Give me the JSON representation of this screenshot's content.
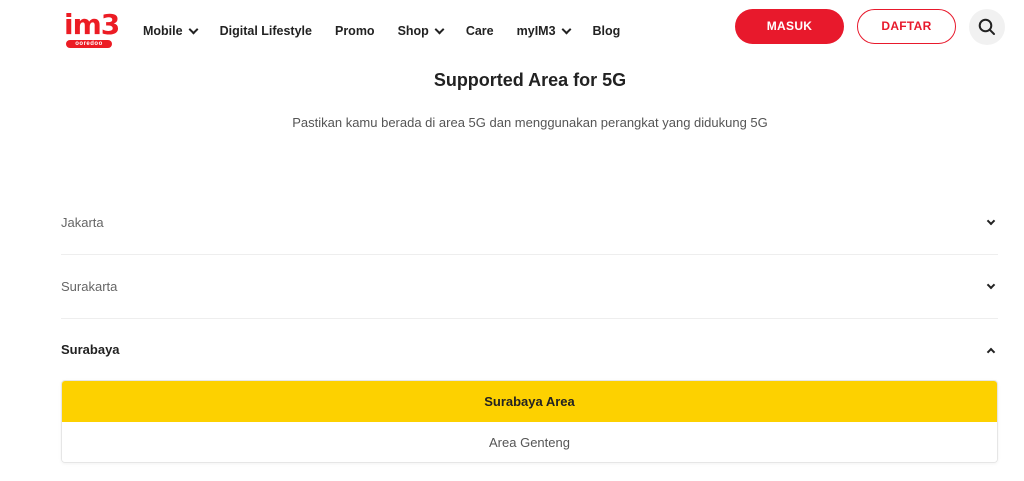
{
  "header": {
    "logo": {
      "main": "im3",
      "sub": "ooredoo"
    },
    "nav": [
      {
        "label": "Mobile",
        "has_dropdown": true
      },
      {
        "label": "Digital Lifestyle",
        "has_dropdown": false
      },
      {
        "label": "Promo",
        "has_dropdown": false
      },
      {
        "label": "Shop",
        "has_dropdown": true
      },
      {
        "label": "Care",
        "has_dropdown": false
      },
      {
        "label": "myIM3",
        "has_dropdown": true
      },
      {
        "label": "Blog",
        "has_dropdown": false
      }
    ],
    "login_label": "MASUK",
    "register_label": "DAFTAR",
    "search_icon": "search-icon"
  },
  "main": {
    "title": "Supported Area for 5G",
    "subtitle": "Pastikan kamu berada di area 5G dan menggunakan perangkat yang didukung 5G",
    "regions": [
      {
        "label": "Jakarta",
        "expanded": false
      },
      {
        "label": "Surakarta",
        "expanded": false
      },
      {
        "label": "Surabaya",
        "expanded": true
      }
    ],
    "expanded_panel": {
      "header": "Surabaya Area",
      "items": [
        "Area Genteng"
      ]
    }
  },
  "colors": {
    "brand_red": "#e8192c",
    "panel_yellow": "#fdd100"
  }
}
